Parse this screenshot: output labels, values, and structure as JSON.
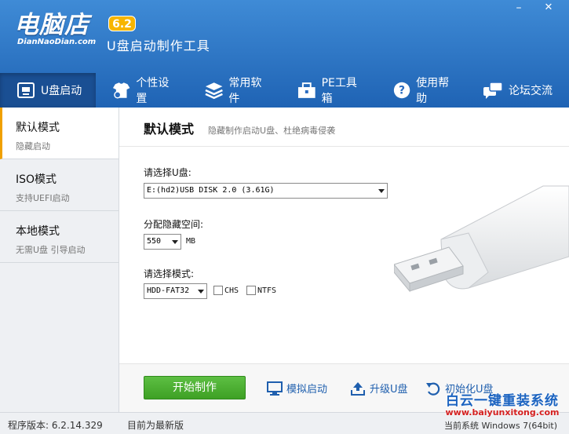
{
  "header": {
    "logo_text": "电脑店",
    "logo_subtext": "DianNaoDian.com",
    "version_badge": "6.2",
    "app_title": "U盘启动制作工具",
    "minimize_label": "–",
    "close_label": "✕"
  },
  "nav": {
    "tabs": [
      {
        "label": "U盘启动",
        "icon": "usb-icon",
        "active": true
      },
      {
        "label": "个性设置",
        "icon": "shirt-gear-icon"
      },
      {
        "label": "常用软件",
        "icon": "stack-icon"
      },
      {
        "label": "PE工具箱",
        "icon": "toolbox-icon"
      },
      {
        "label": "使用帮助",
        "icon": "help-icon"
      },
      {
        "label": "论坛交流",
        "icon": "chat-icon"
      }
    ]
  },
  "sidebar": {
    "items": [
      {
        "title": "默认模式",
        "subtitle": "隐藏启动"
      },
      {
        "title": "ISO模式",
        "subtitle": "支持UEFI启动"
      },
      {
        "title": "本地模式",
        "subtitle": "无需U盘 引导启动"
      }
    ]
  },
  "main": {
    "title": "默认模式",
    "description": "隐藏制作启动U盘、杜绝病毒侵袭",
    "usb_label": "请选择U盘:",
    "usb_value": "E:(hd2)USB DISK 2.0 (3.61G)",
    "hidden_label": "分配隐藏空间:",
    "hidden_value": "550",
    "hidden_unit": "MB",
    "mode_label": "请选择模式:",
    "mode_value": "HDD-FAT32",
    "chs_label": "CHS",
    "ntfs_label": "NTFS",
    "start_button": "开始制作",
    "simulate_label": "模拟启动",
    "upgrade_label": "升级U盘",
    "init_label": "初始化U盘"
  },
  "status": {
    "version": "程序版本: 6.2.14.329",
    "latest": "目前为最新版",
    "os": "当前系统 Windows 7(64bit)"
  },
  "watermark": {
    "title": "白云一键重装系统",
    "url": "www.baiyunxitong.com"
  },
  "colors": {
    "header_top": "#3f8bd6",
    "header_bottom": "#1f63b4",
    "accent": "#f0a000",
    "start_button": "#4caf35",
    "link": "#1f5fae"
  }
}
